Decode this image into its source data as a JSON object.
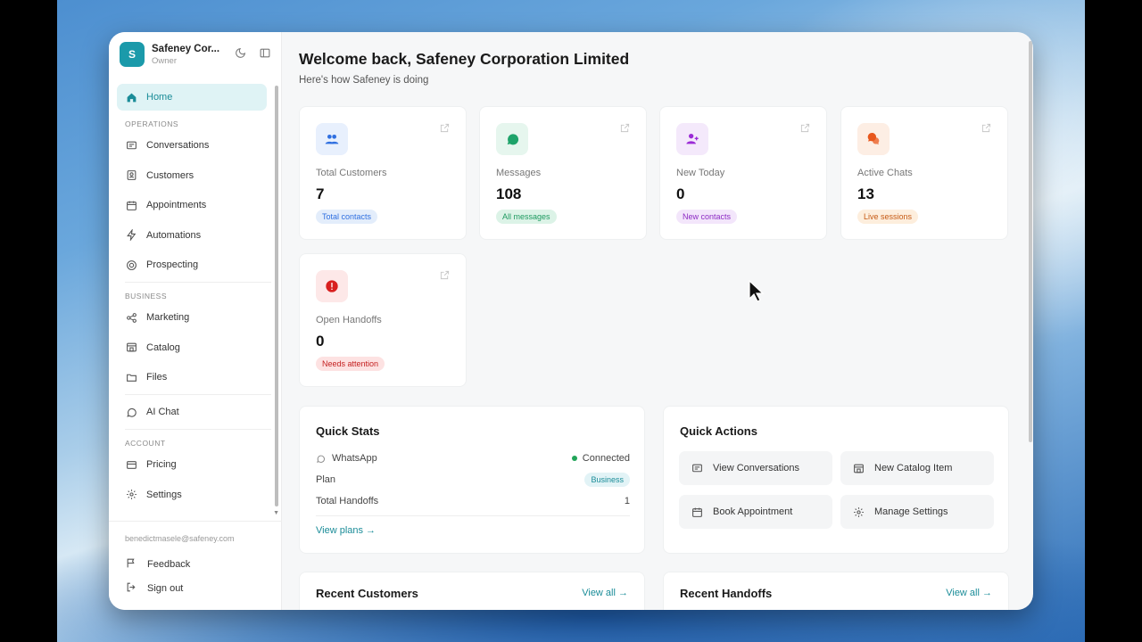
{
  "brand": {
    "initial": "S",
    "name": "Safeney Cor...",
    "role": "Owner"
  },
  "sidebar": {
    "home": "Home",
    "sections": {
      "operations": "OPERATIONS",
      "business": "BUSINESS",
      "account": "ACCOUNT"
    },
    "operations": [
      "Conversations",
      "Customers",
      "Appointments",
      "Automations",
      "Prospecting"
    ],
    "business": [
      "Marketing",
      "Catalog",
      "Files"
    ],
    "ai_chat": "AI Chat",
    "account": [
      "Pricing",
      "Settings"
    ],
    "email": "benedictmasele@safeney.com",
    "feedback": "Feedback",
    "sign_out": "Sign out"
  },
  "header": {
    "title": "Welcome back, Safeney Corporation Limited",
    "subtitle": "Here's how Safeney is doing"
  },
  "cards": [
    {
      "label": "Total Customers",
      "value": "7",
      "pill": "Total contacts",
      "icon": "users-icon",
      "color": "#2f6fe0",
      "bg": "#e8f0fd",
      "pill_bg": "#e3edfb",
      "pill_fg": "#2f6fe0"
    },
    {
      "label": "Messages",
      "value": "108",
      "pill": "All messages",
      "icon": "message-icon",
      "color": "#1ea36a",
      "bg": "#e6f6ee",
      "pill_bg": "#dcf3e7",
      "pill_fg": "#1e9a60"
    },
    {
      "label": "New Today",
      "value": "0",
      "pill": "New contacts",
      "icon": "user-plus-icon",
      "color": "#9b2bd6",
      "bg": "#f4e9fb",
      "pill_bg": "#f3e6fb",
      "pill_fg": "#8d2bc4"
    },
    {
      "label": "Active Chats",
      "value": "13",
      "pill": "Live sessions",
      "icon": "chats-icon",
      "color": "#e8571c",
      "bg": "#fdeee4",
      "pill_bg": "#fdeedd",
      "pill_fg": "#c65a14"
    },
    {
      "label": "Open Handoffs",
      "value": "0",
      "pill": "Needs attention",
      "icon": "alert-icon",
      "color": "#d8201f",
      "bg": "#fde8e8",
      "pill_bg": "#fde2e2",
      "pill_fg": "#c42020"
    }
  ],
  "quick_stats": {
    "title": "Quick Stats",
    "whatsapp_label": "WhatsApp",
    "whatsapp_status": "Connected",
    "plan_label": "Plan",
    "plan_value": "Business",
    "handoffs_label": "Total Handoffs",
    "handoffs_value": "1",
    "view_plans": "View plans →"
  },
  "quick_actions": {
    "title": "Quick Actions",
    "items": [
      "View Conversations",
      "New Catalog Item",
      "Book Appointment",
      "Manage Settings"
    ]
  },
  "recent_customers": {
    "title": "Recent Customers",
    "view_all": "View all →"
  },
  "recent_handoffs": {
    "title": "Recent Handoffs",
    "view_all": "View all →"
  }
}
